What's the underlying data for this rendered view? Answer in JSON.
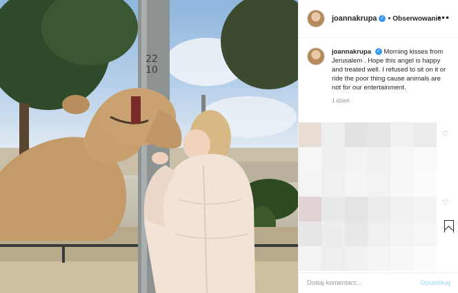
{
  "post": {
    "username": "joannakrupa",
    "follow_label": "Obserwowanie",
    "separator": "•",
    "more_label": "•••",
    "verified_glyph": "✓",
    "caption_username": "joannakrupa",
    "caption_text": " Morning kisses from Jerusalem . Hope this angel is happy and treated well. I refused to sit on it or ride the poor thing cause animals are not for our entertainment.",
    "timestamp": "1 dzień",
    "pole_text": "22 10"
  },
  "comment_box": {
    "placeholder": "Dodaj komentarz...",
    "publish_label": "Opublikuj"
  },
  "icons": {
    "heart": "♡",
    "bookmark": "bookmark-icon"
  },
  "colors": {
    "verified_blue": "#3897f0",
    "publish_disabled": "#b2dffc",
    "text": "#262626",
    "muted": "#8e8e8e"
  }
}
